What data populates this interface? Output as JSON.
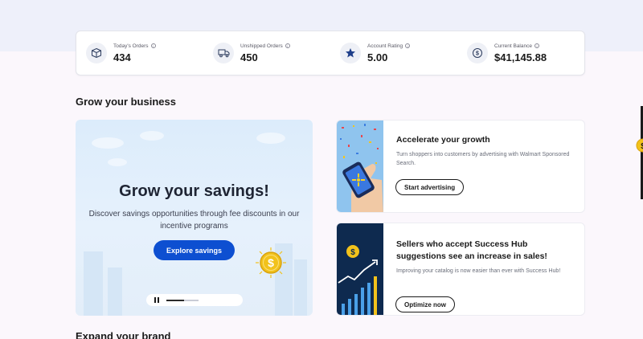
{
  "stats": [
    {
      "label": "Today's Orders",
      "value": "434",
      "icon": "box-icon"
    },
    {
      "label": "Unshipped Orders",
      "value": "450",
      "icon": "truck-icon"
    },
    {
      "label": "Account Rating",
      "value": "5.00",
      "icon": "star-icon"
    },
    {
      "label": "Current Balance",
      "value": "$41,145.88",
      "icon": "dollar-icon"
    }
  ],
  "grow_section": {
    "title": "Grow your business",
    "hero": {
      "title": "Grow your savings!",
      "description": "Discover savings opportunities through fee discounts in our incentive programs",
      "button_label": "Explore savings",
      "carousel_progress": 0.55
    },
    "cards": [
      {
        "title": "Accelerate your growth",
        "description": "Turn shoppers into customers by advertising with Walmart Sponsored Search.",
        "button_label": "Start advertising"
      },
      {
        "title": "Sellers who accept Success Hub suggestions see an increase in sales!",
        "description": "Improving your catalog is now easier than ever with Success Hub!",
        "button_label": "Optimize now"
      }
    ]
  },
  "brand_section": {
    "title": "Expand your brand"
  },
  "colors": {
    "primary": "#0d4fd1",
    "coin": "#f2c21b",
    "hero_bg": "#dcecfb",
    "card_dark": "#0e2a4f"
  }
}
